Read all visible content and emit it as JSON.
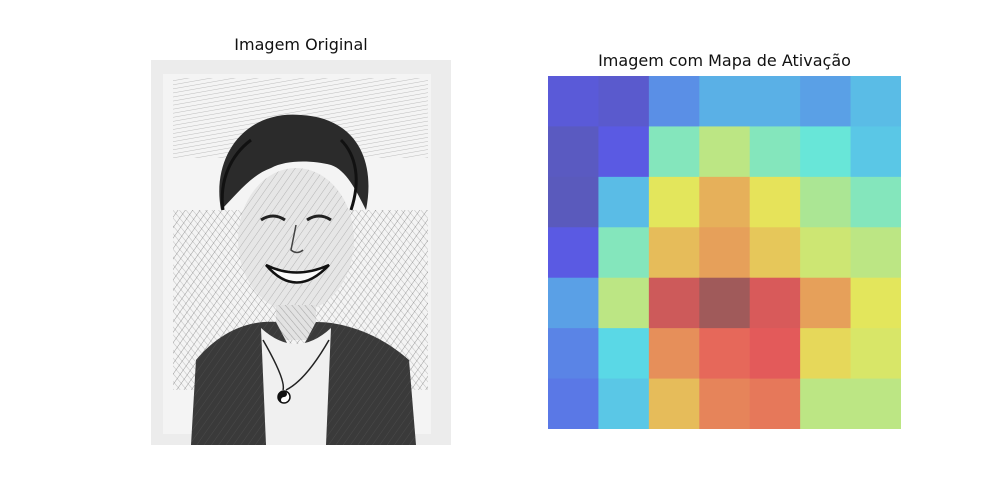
{
  "figure": {
    "left_title": "Imagem Original",
    "right_title": "Imagem com Mapa de Ativação"
  },
  "original_image": {
    "description_icon": "pencil-sketch-portrait"
  },
  "chart_data": {
    "type": "heatmap",
    "title": "Imagem com Mapa de Ativação",
    "xlabel": "",
    "ylabel": "",
    "rows": 7,
    "cols": 7,
    "grid": false,
    "axes_visible": false,
    "colormap": "jet",
    "alpha": 0.55,
    "values": [
      [
        0.1,
        0.08,
        0.22,
        0.28,
        0.28,
        0.25,
        0.3
      ],
      [
        0.06,
        0.12,
        0.45,
        0.55,
        0.45,
        0.4,
        0.32
      ],
      [
        0.05,
        0.3,
        0.62,
        0.72,
        0.63,
        0.52,
        0.45
      ],
      [
        0.12,
        0.45,
        0.7,
        0.75,
        0.68,
        0.58,
        0.55
      ],
      [
        0.25,
        0.55,
        0.92,
        1.0,
        0.9,
        0.75,
        0.62
      ],
      [
        0.2,
        0.35,
        0.78,
        0.85,
        0.88,
        0.65,
        0.6
      ],
      [
        0.18,
        0.32,
        0.7,
        0.8,
        0.82,
        0.55,
        0.55
      ]
    ]
  }
}
